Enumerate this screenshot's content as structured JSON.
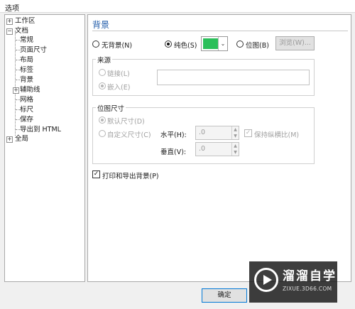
{
  "window": {
    "title": "选项"
  },
  "tree": {
    "items": [
      {
        "label": "工作区",
        "level": 0,
        "expander": "+"
      },
      {
        "label": "文档",
        "level": 0,
        "expander": "−"
      },
      {
        "label": "常规",
        "level": 1
      },
      {
        "label": "页面尺寸",
        "level": 1
      },
      {
        "label": "布局",
        "level": 1
      },
      {
        "label": "标签",
        "level": 1
      },
      {
        "label": "背景",
        "level": 1
      },
      {
        "label": "辅助线",
        "level": 1,
        "expander": "+"
      },
      {
        "label": "网格",
        "level": 1
      },
      {
        "label": "标尺",
        "level": 1
      },
      {
        "label": "保存",
        "level": 1
      },
      {
        "label": "导出到 HTML",
        "level": 1
      },
      {
        "label": "全局",
        "level": 0,
        "expander": "+"
      }
    ]
  },
  "panel": {
    "heading": "背景",
    "background_type": {
      "none_label": "无背景(N)",
      "solid_label": "纯色(S)",
      "bitmap_label": "位图(B)",
      "selected": "solid",
      "solid_color": "#2bbf5a",
      "browse_label": "浏览(W)..."
    },
    "source": {
      "title": "来源",
      "link_label": "链接(L)",
      "embed_label": "嵌入(E)"
    },
    "bitmap_size": {
      "title": "位图尺寸",
      "default_label": "默认尺寸(D)",
      "custom_label": "自定义尺寸(C)",
      "horizontal_label": "水平(H):",
      "horizontal_value": ".0",
      "vertical_label": "垂直(V):",
      "vertical_value": ".0",
      "keep_ratio_label": "保持纵横比(M)"
    },
    "print_export_label": "打印和导出背景(P)"
  },
  "footer": {
    "ok_label": "确定"
  },
  "watermark": {
    "name": "溜溜自学",
    "url": "ZIXUE.3D66.COM"
  },
  "icons": {
    "expander_plus": "plus-box-icon",
    "expander_minus": "minus-box-icon",
    "dropdown": "chevron-down-icon",
    "check": "check-icon",
    "play": "play-logo-icon"
  }
}
